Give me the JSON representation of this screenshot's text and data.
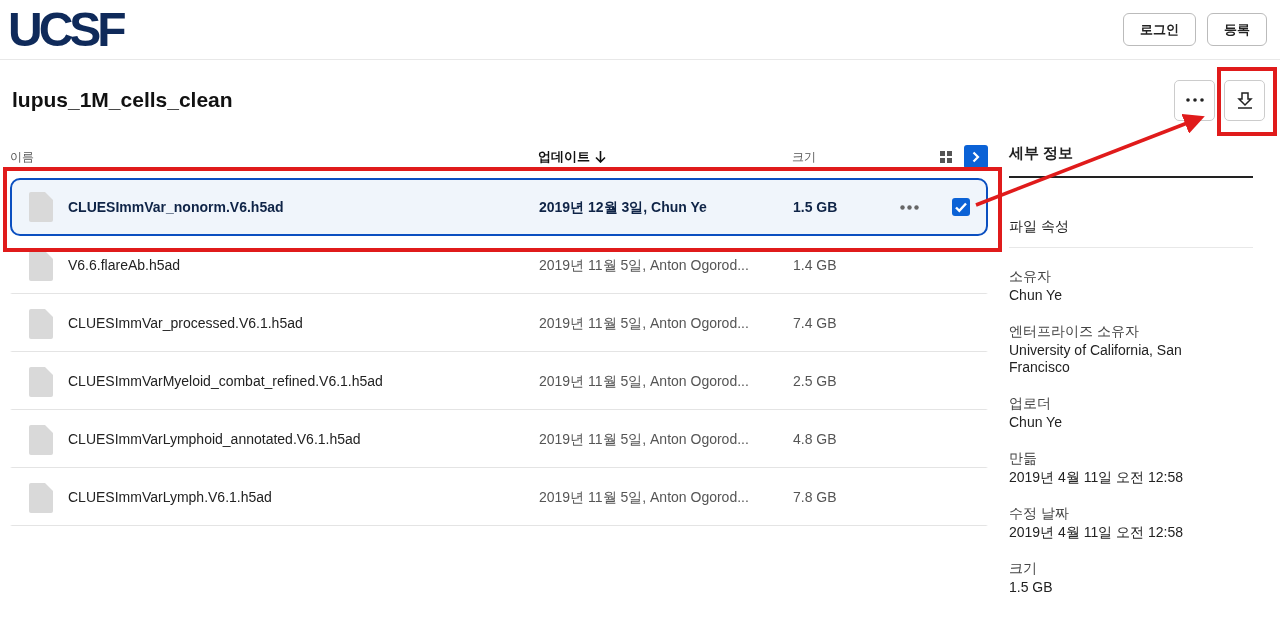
{
  "logo": "UCSF",
  "header_buttons": [
    "로그인",
    "등록"
  ],
  "title": "lupus_1M_cells_clean",
  "columns": [
    {
      "label": "이름",
      "sorted": false
    },
    {
      "label": "업데이트",
      "sorted": true
    },
    {
      "label": "크기",
      "sorted": false
    }
  ],
  "rows": [
    {
      "name": "CLUESImmVar_nonorm.V6.h5ad",
      "updated": "2019년 12월 3일, Chun Ye",
      "size": "1.5 GB",
      "selected": true
    },
    {
      "name": "V6.6.flareAb.h5ad",
      "updated": "2019년 11월 5일, Anton Ogorod...",
      "size": "1.4 GB",
      "selected": false
    },
    {
      "name": "CLUESImmVar_processed.V6.1.h5ad",
      "updated": "2019년 11월 5일, Anton Ogorod...",
      "size": "7.4 GB",
      "selected": false
    },
    {
      "name": "CLUESImmVarMyeloid_combat_refined.V6.1.h5ad",
      "updated": "2019년 11월 5일, Anton Ogorod...",
      "size": "2.5 GB",
      "selected": false
    },
    {
      "name": "CLUESImmVarLymphoid_annotated.V6.1.h5ad",
      "updated": "2019년 11월 5일, Anton Ogorod...",
      "size": "4.8 GB",
      "selected": false
    },
    {
      "name": "CLUESImmVarLymph.V6.1.h5ad",
      "updated": "2019년 11월 5일, Anton Ogorod...",
      "size": "7.8 GB",
      "selected": false
    }
  ],
  "details": {
    "title": "세부 정보",
    "section": "파일 속성",
    "properties": [
      {
        "label": "소유자",
        "value": "Chun Ye"
      },
      {
        "label": "엔터프라이즈 소유자",
        "value": "University of California, San Francisco"
      },
      {
        "label": "업로더",
        "value": "Chun Ye"
      },
      {
        "label": "만듦",
        "value": "2019년 4월 11일 오전 12:58"
      },
      {
        "label": "수정 날짜",
        "value": "2019년 4월 11일 오전 12:58"
      },
      {
        "label": "크기",
        "value": "1.5 GB"
      }
    ]
  }
}
